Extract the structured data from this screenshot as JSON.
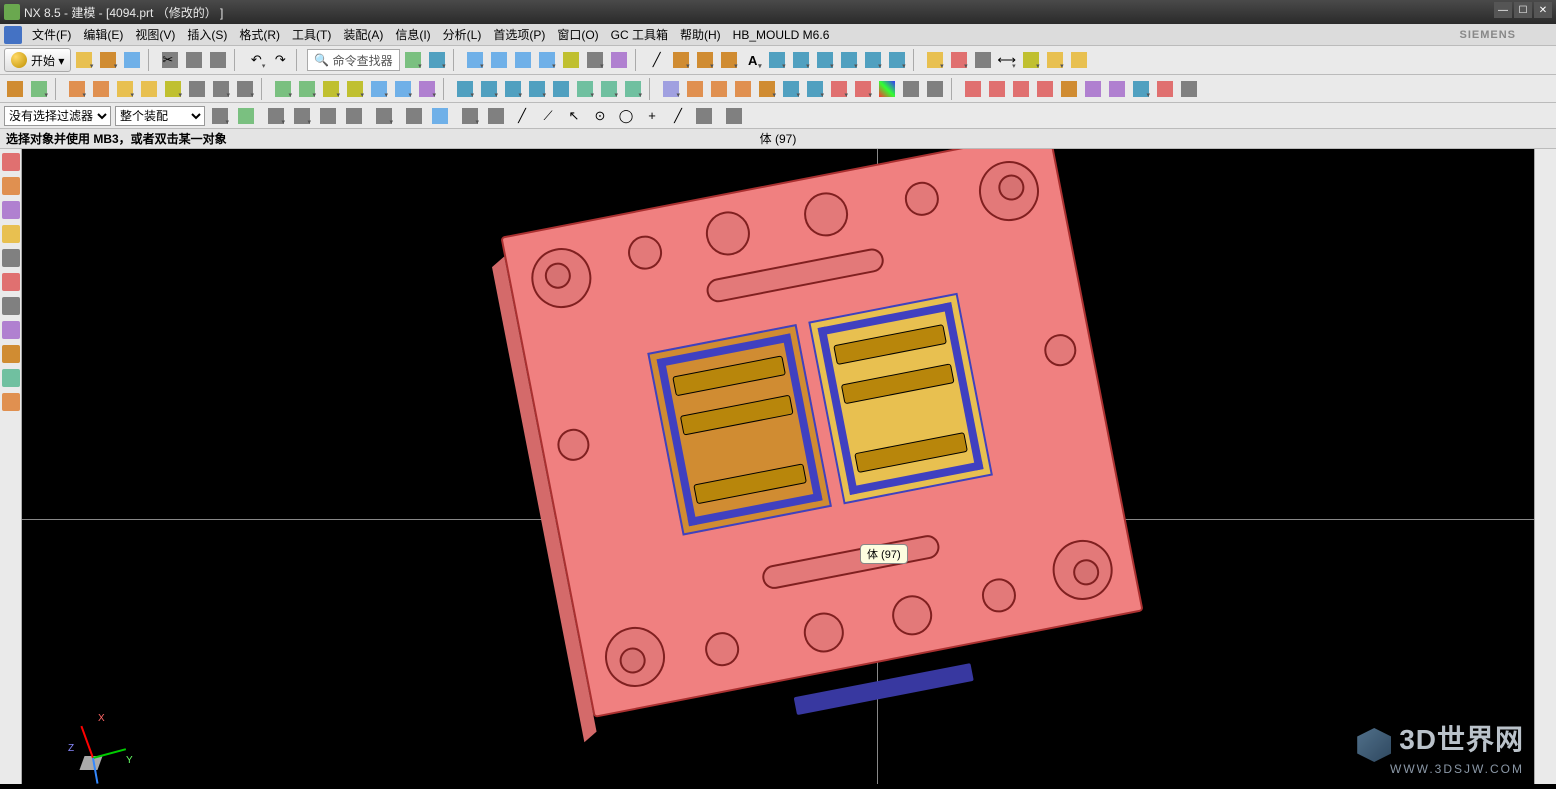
{
  "title": "NX 8.5 - 建模 - [4094.prt （修改的） ]",
  "brand": "SIEMENS",
  "menus": [
    "文件(F)",
    "编辑(E)",
    "视图(V)",
    "插入(S)",
    "格式(R)",
    "工具(T)",
    "装配(A)",
    "信息(I)",
    "分析(L)",
    "首选项(P)",
    "窗口(O)",
    "GC 工具箱",
    "帮助(H)",
    "HB_MOULD M6.6"
  ],
  "start_label": "开始 ▾",
  "cmd_finder": "命令查找器",
  "filter": {
    "label": "没有选择过滤器",
    "assembly": "整个装配"
  },
  "prompt": "选择对象并使用 MB3，或者双击某一对象",
  "selection_info": "体 (97)",
  "tooltip": "体 (97)",
  "triad": {
    "x": "X",
    "y": "Y",
    "z": "Z"
  },
  "watermark": {
    "title": "3D世界网",
    "sub": "WWW.3DSJW.COM"
  }
}
